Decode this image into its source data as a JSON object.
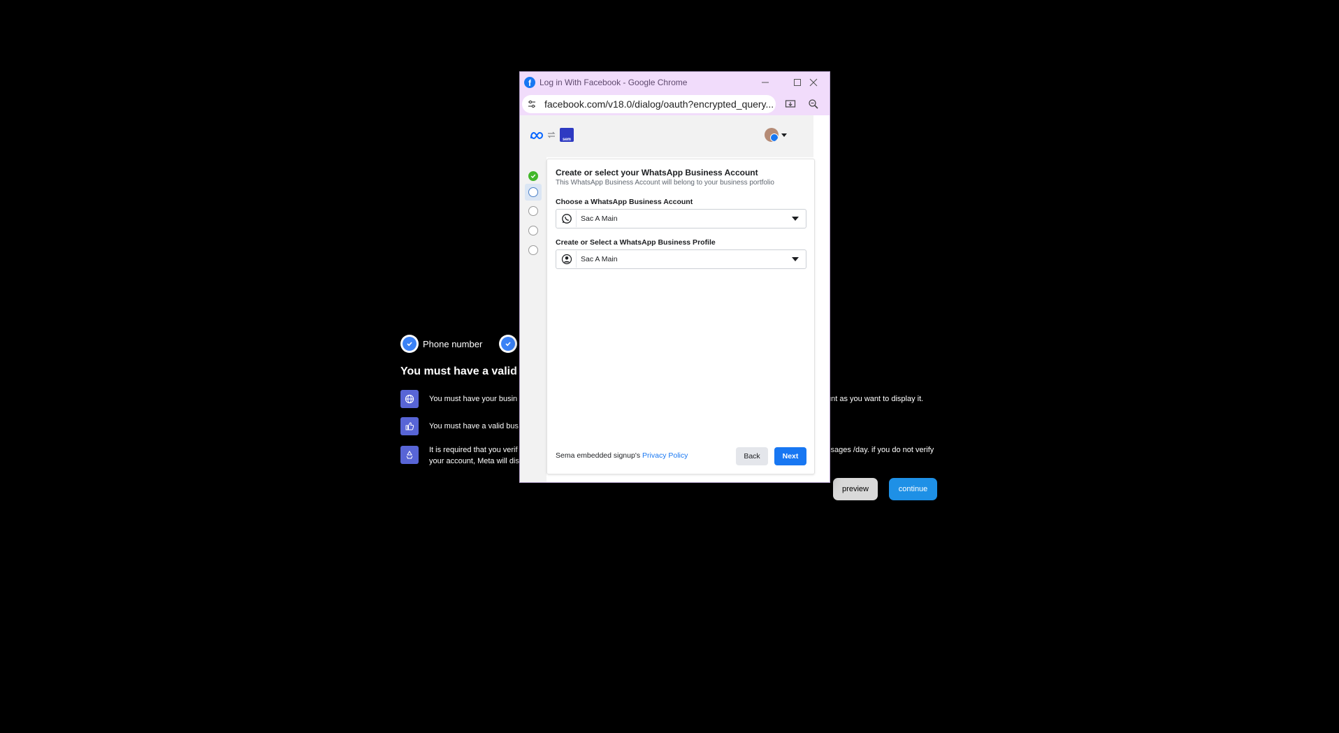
{
  "background": {
    "step_label": "Phone number",
    "heading": "You must have a valid a",
    "requirements": [
      {
        "icon": "globe-icon",
        "text_left": "You must have your busin",
        "text_right": "unt as you want to display it."
      },
      {
        "icon": "thumbs-up-icon",
        "text_left": "You must have a valid bus"
      },
      {
        "icon": "recycle-icon",
        "text_left_line1": "It is required that you verif",
        "text_left_line2": "your account, Meta will dis",
        "text_right": "ssages /day. if you do not verify"
      }
    ],
    "preview_label": "preview",
    "continue_label": "continue"
  },
  "window": {
    "title": "Log in With Facebook - Google Chrome",
    "url": "facebook.com/v18.0/dialog/oauth?encrypted_query...",
    "app_badge": "sem"
  },
  "dialog": {
    "title": "Create or select your WhatsApp Business Account",
    "subtitle": "This WhatsApp Business Account will belong to your business portfolio",
    "account_label": "Choose a WhatsApp Business Account",
    "account_value": "Sac A Main",
    "profile_label": "Create or Select a WhatsApp Business Profile",
    "profile_value": "Sac A Main",
    "footer_prefix": "Sema embedded signup's ",
    "privacy_link": "Privacy Policy",
    "back_label": "Back",
    "next_label": "Next"
  },
  "colors": {
    "accent": "#1877f2",
    "titlebar": "#f1dcfb",
    "step_done": "#42b72a",
    "bg_icon": "#5865d6",
    "continue": "#1e90e6"
  }
}
